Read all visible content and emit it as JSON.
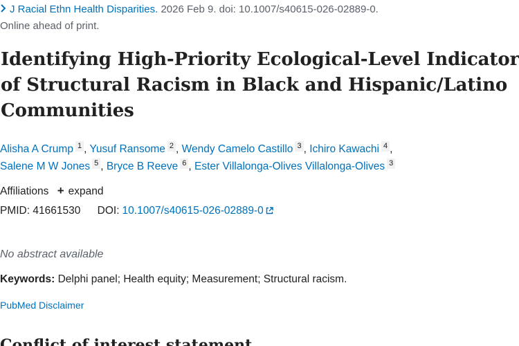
{
  "citation": {
    "journal": "J Racial Ethn Health Disparities.",
    "pub_info": "2026 Feb 9. doi: 10.1007/s40615-026-02889-0.",
    "print_status": "Online ahead of print."
  },
  "article": {
    "title_lines": [
      "Identifying High-Priority Ecological-Level Indicators",
      "of Structural Racism in Black and Hispanic/Latino",
      "Communities"
    ]
  },
  "authors": [
    {
      "name": "Alisha A Crump",
      "aff": "1"
    },
    {
      "name": "Yusuf Ransome",
      "aff": "2"
    },
    {
      "name": "Wendy Camelo Castillo",
      "aff": "3"
    },
    {
      "name": "Ichiro Kawachi",
      "aff": "4"
    },
    {
      "name": "Salene M W Jones",
      "aff": "5"
    },
    {
      "name": "Bryce B Reeve",
      "aff": "6"
    },
    {
      "name": "Ester Villalonga-Olives Villalonga-Olives",
      "aff": "3"
    }
  ],
  "affiliations": {
    "label": "Affiliations",
    "expand_label": "expand"
  },
  "identifiers": {
    "pmid_label": "PMID:",
    "pmid": "41661530",
    "doi_label": "DOI:",
    "doi": "10.1007/s40615-026-02889-0"
  },
  "abstract": {
    "empty_text": "No abstract available"
  },
  "keywords": {
    "label": "Keywords:",
    "text": "Delphi panel; Health equity; Measurement; Structural racism."
  },
  "disclaimer_label": "PubMed Disclaimer",
  "sections": {
    "conflict_heading": "Conflict of interest statement"
  },
  "icons": {
    "journal_expand": "chevron-right-icon",
    "affiliations_expand": "plus-icon",
    "doi_external": "external-link-icon"
  },
  "colors": {
    "link": "#0071bc",
    "text": "#212121",
    "muted": "#5b616b"
  }
}
